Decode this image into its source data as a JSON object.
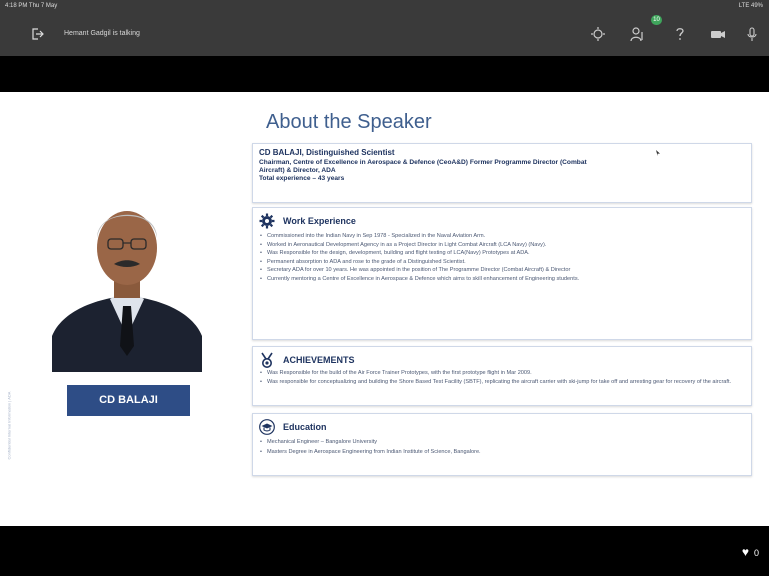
{
  "status": {
    "time": "4:18 PM  Thu 7 May",
    "right": "LTE 49%"
  },
  "topbar": {
    "talking": "Hemant Gadgil is talking",
    "badge": "10",
    "icons": [
      "leave-icon",
      "brightness-icon",
      "participants-icon",
      "help-icon",
      "camera-icon",
      "microphone-icon"
    ]
  },
  "slide": {
    "side_text": "Confidential Internal Information | ADA",
    "title": "About the Speaker",
    "name_tag": "CD BALAJI",
    "speaker": {
      "name": "CD BALAJI, Distinguished Scientist",
      "line1": "Chairman, Centre of Excellence in Aerospace & Defence (CeoA&D) Former Programme Director (Combat",
      "line2": "Aircraft) & Director, ADA",
      "line3": "Total experience – 43 years"
    },
    "work": {
      "title": "Work Experience",
      "items": [
        "Commissioned into the Indian Navy in Sep 1978 - Specialized in the Naval Aviation Arm.",
        "Worked in Aeronautical Development Agency in as a Project Director in Light Combat Aircraft (LCA Navy) (Navy).",
        "Was Responsible for the design, development, building and flight testing of LCA(Navy) Prototypes at ADA.",
        "Permanent absorption to ADA and rose to the grade of a Distinguished Scientist.",
        "Secretary ADA for over 10 years. He was appointed in the position of The Programme Director (Combat Aircraft) & Director",
        "Currently mentoring a Centre of Excellence in Aerospace & Defence which aims to skill enhancement of Engineering students."
      ]
    },
    "achievements": {
      "title": "ACHIEVEMENTS",
      "items": [
        "Was Responsible for the build of the Air Force Trainer Prototypes, with the first prototype flight in Mar 2009.",
        "Was responsible for conceptualizing and building the Shore Based Test Facility (SBTF), replicating the aircraft carrier with ski-jump for take off and arresting gear for recovery of the aircraft."
      ]
    },
    "education": {
      "title": "Education",
      "items": [
        "Mechanical Engineer – Bangalore University",
        "Masters Degree in Aerospace Engineering from Indian Institute of Science, Bangalore."
      ]
    }
  },
  "footer": {
    "reactions_count": "0"
  }
}
